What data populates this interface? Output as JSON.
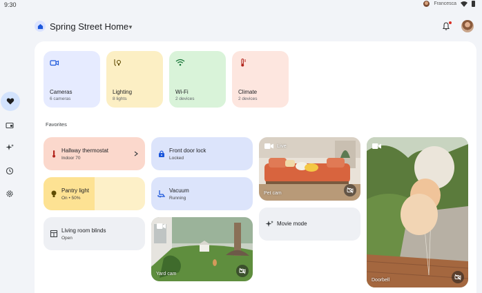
{
  "status": {
    "time": "9:30",
    "user": "Francesca"
  },
  "header": {
    "home_name": "Spring Street Home"
  },
  "nav": {
    "items": [
      {
        "icon": "heart-icon",
        "active": true
      },
      {
        "icon": "devices-icon",
        "active": false
      },
      {
        "icon": "sparkle-icon",
        "active": false
      },
      {
        "icon": "history-icon",
        "active": false
      },
      {
        "icon": "settings-icon",
        "active": false
      }
    ]
  },
  "devices": [
    {
      "name": "Cameras",
      "sub": "6 cameras",
      "color": "#e6ebff",
      "icon": "camera-icon"
    },
    {
      "name": "Lighting",
      "sub": "8 lights",
      "color": "#fcefc4",
      "icon": "lighting-icon"
    },
    {
      "name": "Wi-Fi",
      "sub": "2 devices",
      "color": "#d9f3d9",
      "icon": "wifi-icon"
    },
    {
      "name": "Climate",
      "sub": "2 devices",
      "color": "#fde6df",
      "icon": "thermostat-icon"
    }
  ],
  "favorites_label": "Favorites",
  "favorites": {
    "thermostat": {
      "name": "Hallway thermostat",
      "sub": "Indoor 70"
    },
    "front_door": {
      "name": "Front door lock",
      "sub": "Locked"
    },
    "pantry": {
      "name": "Pantry light",
      "sub": "On • 50%",
      "level_percent": 50
    },
    "vacuum": {
      "name": "Vacuum",
      "sub": "Running"
    },
    "blinds": {
      "name": "Living room blinds",
      "sub": "Open"
    },
    "movie": {
      "name": "Movie mode"
    }
  },
  "cameras": {
    "pet": {
      "caption": "Pet cam",
      "live": "Live"
    },
    "yard": {
      "caption": "Yard cam"
    },
    "doorbell": {
      "caption": "Doorbell"
    }
  },
  "colors": {
    "thermostat_tile": "#fbd8cc",
    "blue_tile": "#dce4fb",
    "pantry_on": "#fde293",
    "pantry_off": "#fdf0c8",
    "gray_tile": "#eef0f4",
    "accent": "#1a56db"
  }
}
